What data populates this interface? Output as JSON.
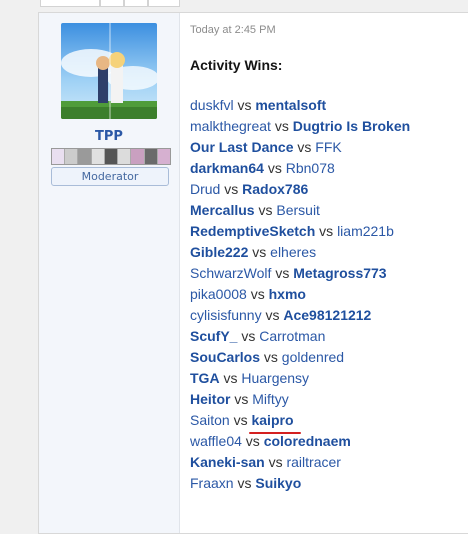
{
  "post": {
    "timestamp": "Today at 2:45 PM",
    "heading": "Activity Wins:",
    "author": {
      "name": "TPP",
      "role": "Moderator",
      "avatar": "avatar-image",
      "badges": [
        "badge-1",
        "badge-2",
        "badge-3",
        "badge-4",
        "badge-5",
        "badge-6",
        "badge-7",
        "badge-8",
        "badge-9"
      ]
    },
    "vs_label": "vs",
    "matches": [
      {
        "left": "duskfvl",
        "right": "mentalsoft",
        "winner": "right"
      },
      {
        "left": "malkthegreat",
        "right": "Dugtrio Is Broken",
        "winner": "right"
      },
      {
        "left": "Our Last Dance",
        "right": "FFK",
        "winner": "left"
      },
      {
        "left": "darkman64",
        "right": "Rbn078",
        "winner": "left"
      },
      {
        "left": "Drud",
        "right": "Radox786",
        "winner": "right"
      },
      {
        "left": "Mercallus",
        "right": "Bersuit",
        "winner": "left"
      },
      {
        "left": "RedemptiveSketch",
        "right": "liam221b",
        "winner": "left"
      },
      {
        "left": "Gible222",
        "right": "elheres",
        "winner": "left"
      },
      {
        "left": "SchwarzWolf",
        "right": "Metagross773",
        "winner": "right"
      },
      {
        "left": "pika0008",
        "right": "hxmo",
        "winner": "right"
      },
      {
        "left": "cylisisfunny",
        "right": "Ace98121212",
        "winner": "right"
      },
      {
        "left": "ScufY_",
        "right": "Carrotman",
        "winner": "left"
      },
      {
        "left": "SouCarlos",
        "right": "goldenred",
        "winner": "left"
      },
      {
        "left": "TGA",
        "right": "Huargensy",
        "winner": "left"
      },
      {
        "left": "Heitor",
        "right": "Miftyy",
        "winner": "left"
      },
      {
        "left": "Saiton",
        "right": "kaipro",
        "winner": "right"
      },
      {
        "left": "waffle04",
        "right": "colorednaem",
        "winner": "right"
      },
      {
        "left": "Kaneki-san",
        "right": "railtracer",
        "winner": "left"
      },
      {
        "left": "Fraaxn",
        "right": "Suikyo",
        "winner": "right"
      }
    ]
  },
  "colors": {
    "link": "#2b58a6",
    "winner": "#1f4f9e",
    "annotation": "#d42020"
  }
}
